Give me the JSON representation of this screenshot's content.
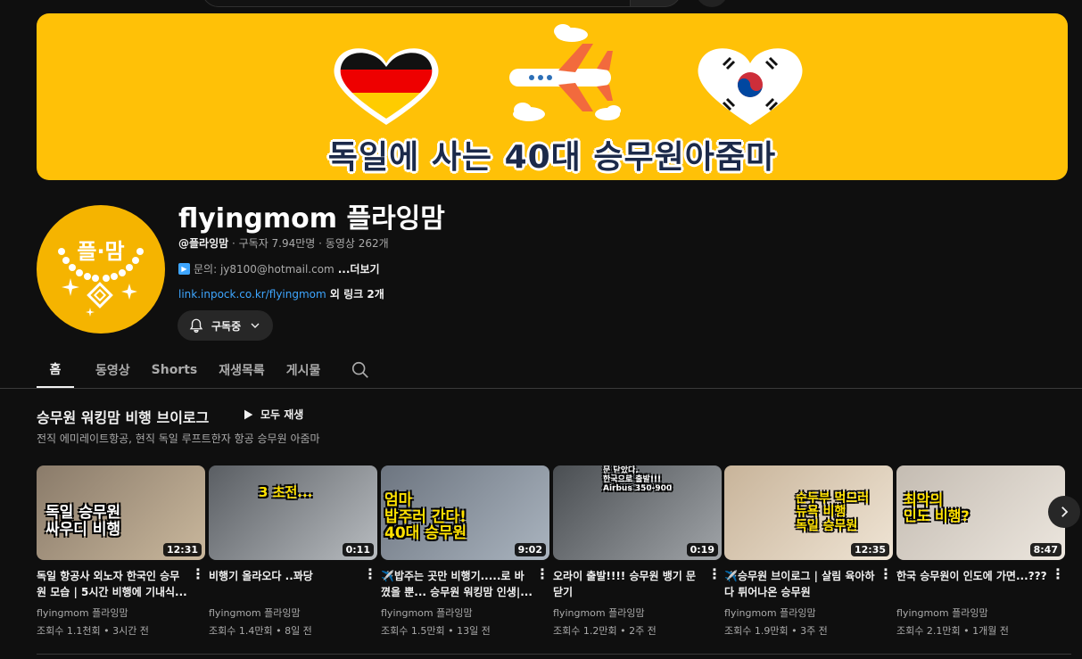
{
  "banner": {
    "caption": "독일에 사는 40대 승무원아줌마"
  },
  "avatar": {
    "text": "플·맘"
  },
  "channel": {
    "title": "flyingmom 플라잉맘",
    "handle": "@플라잉맘",
    "meta": " · 구독자 7.94만명 · 동영상 262개",
    "desc": "문의: jy8100@hotmail.com",
    "more": "...더보기",
    "link_url": "link.inpock.co.kr/flyingmom",
    "link_extra": " 외 링크 2개",
    "subscribe_label": "구독중"
  },
  "tabs": [
    {
      "label": "홈"
    },
    {
      "label": "동영상"
    },
    {
      "label": "Shorts"
    },
    {
      "label": "재생목록"
    },
    {
      "label": "게시물"
    }
  ],
  "section": {
    "title": "승무원 워킹맘 비행 브이로그",
    "play_all": "모두 재생",
    "subtitle": "전직 에미레이트항공, 현직 독일 루프트한자 항공 승무원 아줌마"
  },
  "videos": [
    {
      "title": "독일 항공사 외노자 한국인 승무원 모습 | 5시간 비행에 기내식...",
      "channel": "flyingmom 플라잉맘",
      "stats": "조회수 1.1천회 • 3시간 전",
      "duration": "12:31",
      "thumb_text": "독일 승무원\n싸우디 비행",
      "color1": "#8a7b6a",
      "color2": "#c9b79c"
    },
    {
      "title": "비행기 올라오다 ..꽈당",
      "channel": "flyingmom 플라잉맘",
      "stats": "조회수 1.4만회 • 8일 전",
      "duration": "0:11",
      "thumb_text": "3 초전...",
      "color1": "#5a5e63",
      "color2": "#b8bcc0"
    },
    {
      "title": "✈️밥주는 곳만 비행기.....로 바꼈을 뿐... 승무원 워킹맘 인생|...",
      "channel": "flyingmom 플라잉맘",
      "stats": "조회수 1.5만회 • 13일 전",
      "duration": "9:02",
      "thumb_text": "엄마\n밥주러 간다!\n40대 승무원",
      "color1": "#6d7580",
      "color2": "#aab4bf"
    },
    {
      "title": "오라이 출발!!!! 승무원 뱅기 문닫기",
      "channel": "flyingmom 플라잉맘",
      "stats": "조회수 1.2만회 • 2주 전",
      "duration": "0:19",
      "thumb_text": "문 닫았다.\n한국으로 출발!!!\nAirbus 350-900",
      "color1": "#4a4e52",
      "color2": "#a0a4a8"
    },
    {
      "title": "✈️승무원 브이로그 | 살림 육아하다 튀어나온 승무원",
      "channel": "flyingmom 플라잉맘",
      "stats": "조회수 1.9만회 • 3주 전",
      "duration": "12:35",
      "thumb_text": "순두부 먹으러\n뉴욕 비행\n독일 승무원",
      "color1": "#c8b49a",
      "color2": "#efe4d4"
    },
    {
      "title": "한국 승무원이 인도에 가면...???",
      "channel": "flyingmom 플라잉맘",
      "stats": "조회수 2.1만회 • 1개월 전",
      "duration": "8:47",
      "thumb_text": "최악의\n인도 비행?",
      "color1": "#c4bcb2",
      "color2": "#ece6de"
    }
  ]
}
